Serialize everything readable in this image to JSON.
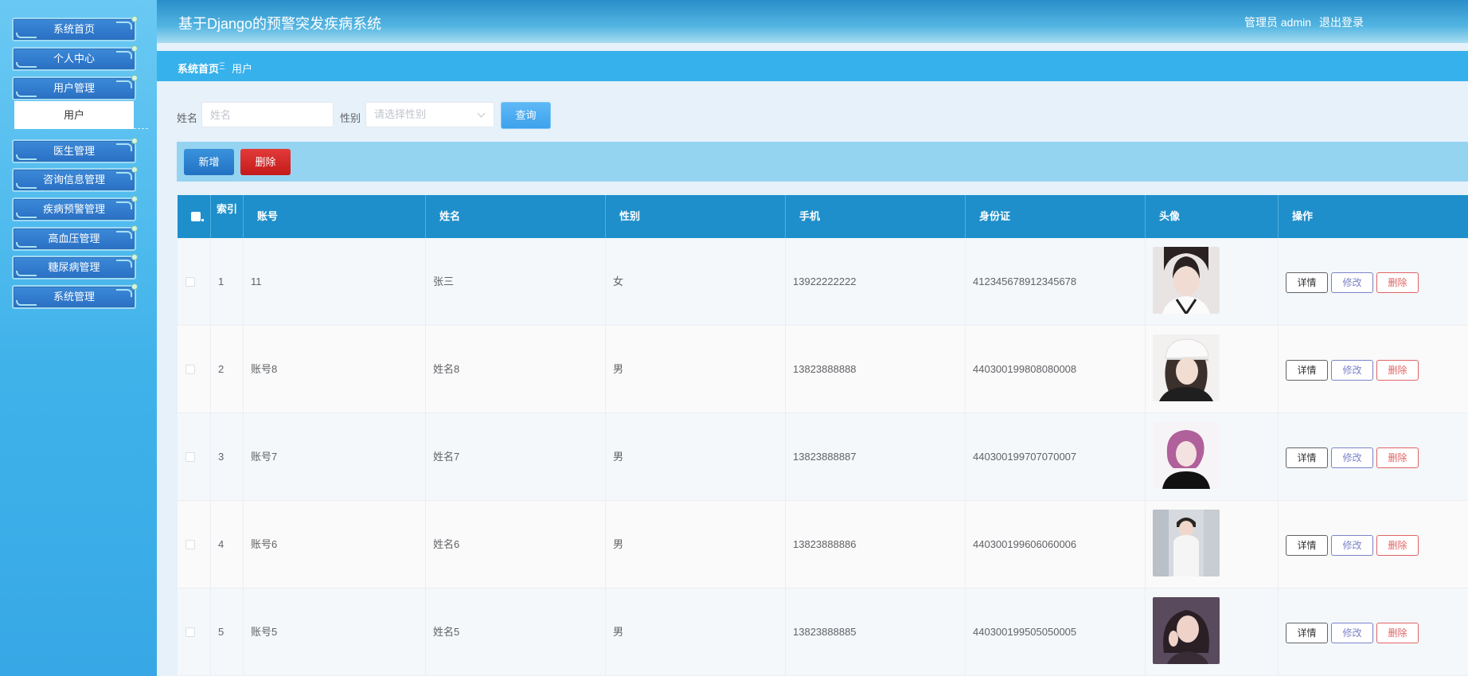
{
  "sidebar": {
    "items": [
      {
        "label": "系统首页"
      },
      {
        "label": "个人中心"
      },
      {
        "label": "用户管理"
      },
      {
        "label": "医生管理"
      },
      {
        "label": "咨询信息管理"
      },
      {
        "label": "疾病预警管理"
      },
      {
        "label": "高血压管理"
      },
      {
        "label": "糖尿病管理"
      },
      {
        "label": "系统管理"
      }
    ],
    "submenu": {
      "label": "用户"
    }
  },
  "header": {
    "title": "基于Django的预警突发疾病系统",
    "user": "管理员 admin",
    "logout": "退出登录"
  },
  "breadcrumb": {
    "home": "系统首页",
    "separator": "Ξ",
    "current": "用户"
  },
  "search": {
    "name_label": "姓名",
    "name_placeholder": "姓名",
    "gender_label": "性别",
    "gender_placeholder": "请选择性别",
    "query_button": "查询"
  },
  "actions": {
    "add": "新增",
    "delete": "删除"
  },
  "table": {
    "columns": {
      "index": "索引",
      "account": "账号",
      "name": "姓名",
      "gender": "性别",
      "phone": "手机",
      "id_card": "身份证",
      "avatar": "头像",
      "operations": "操作"
    },
    "rows": [
      {
        "index": "1",
        "account": "11",
        "name": "张三",
        "gender": "女",
        "phone": "13922222222",
        "id_card": "412345678912345678"
      },
      {
        "index": "2",
        "account": "账号8",
        "name": "姓名8",
        "gender": "男",
        "phone": "13823888888",
        "id_card": "440300199808080008"
      },
      {
        "index": "3",
        "account": "账号7",
        "name": "姓名7",
        "gender": "男",
        "phone": "13823888887",
        "id_card": "440300199707070007"
      },
      {
        "index": "4",
        "account": "账号6",
        "name": "姓名6",
        "gender": "男",
        "phone": "13823888886",
        "id_card": "440300199606060006"
      },
      {
        "index": "5",
        "account": "账号5",
        "name": "姓名5",
        "gender": "男",
        "phone": "13823888885",
        "id_card": "440300199505050005"
      }
    ],
    "row_actions": {
      "detail": "详情",
      "edit": "修改",
      "delete": "删除"
    }
  },
  "colors": {
    "header": "#2a8fc9",
    "breadcrumb": "#36b1eb",
    "table_head": "#1e8fcb",
    "add": "#2a7acb",
    "delete": "#d02424"
  }
}
